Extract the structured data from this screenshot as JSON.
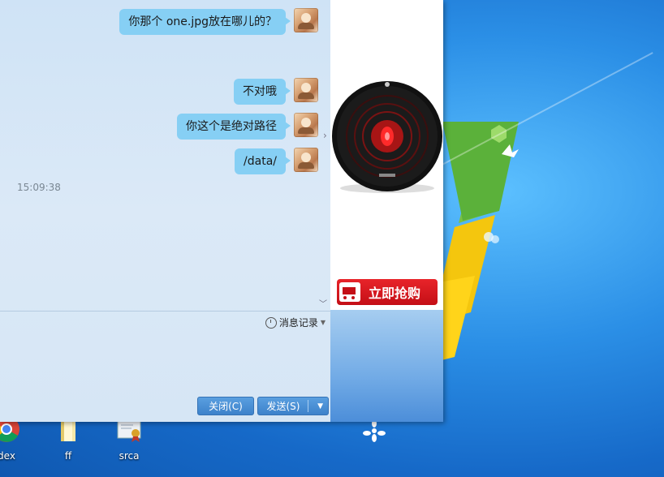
{
  "messages": [
    {
      "text": "你那个 one.jpg放在哪儿的？"
    },
    {
      "text": "不对哦"
    },
    {
      "text": "你这个是绝对路径"
    },
    {
      "text": "/data/"
    }
  ],
  "timestamp": "15:09:38",
  "toolbar": {
    "history_label": "消息记录",
    "close_label": "关闭(C)",
    "send_label": "发送(S)"
  },
  "ad": {
    "buy_label": "立即抢购"
  },
  "desktop_icons": [
    {
      "label": "dex",
      "icon": "chrome-icon"
    },
    {
      "label": "ff",
      "icon": "folder-icon"
    },
    {
      "label": "srca",
      "icon": "certificate-icon"
    }
  ],
  "colors": {
    "bubble": "#86cff4",
    "button": "#3d82cb",
    "buy_button": "#c40f16"
  }
}
